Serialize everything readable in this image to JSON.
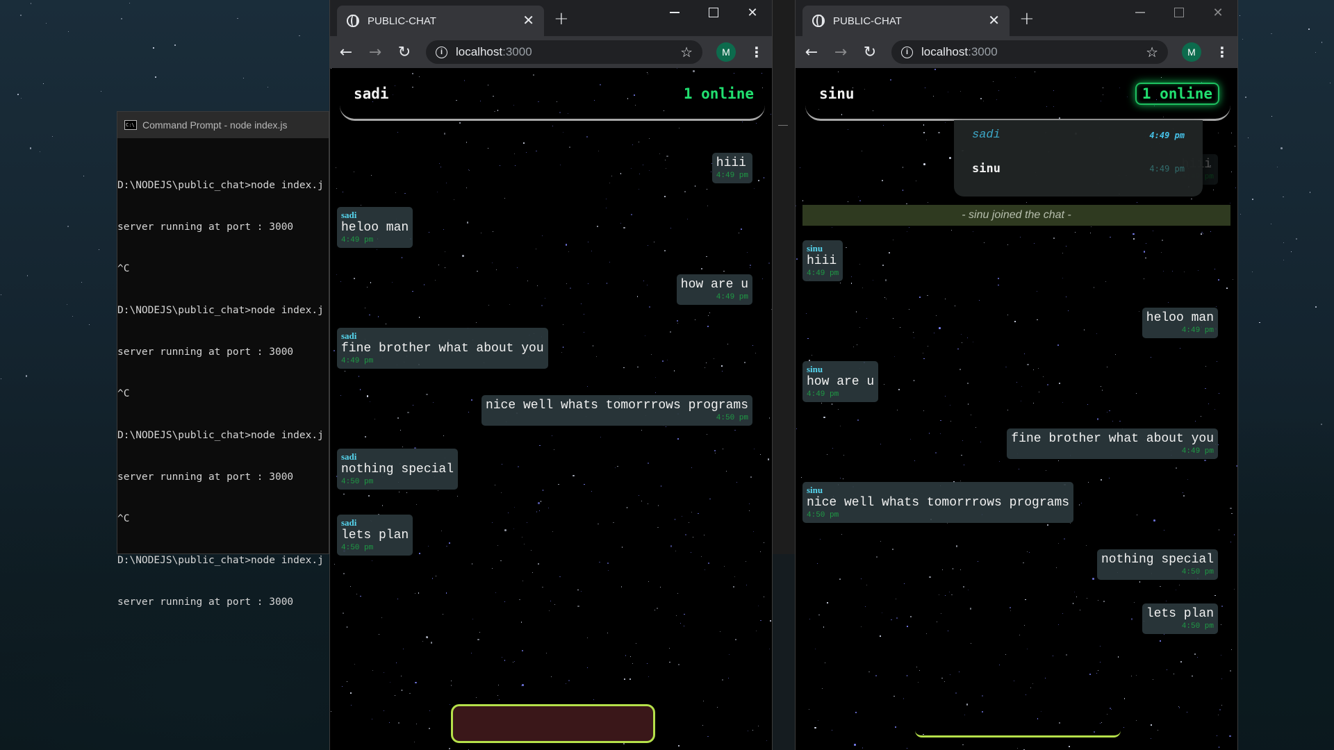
{
  "cmd": {
    "title": "Command Prompt - node  index.js",
    "lines": [
      "D:\\NODEJS\\public_chat>node index.j",
      "server running at port : 3000",
      "^C",
      "D:\\NODEJS\\public_chat>node index.j",
      "server running at port : 3000",
      "^C",
      "D:\\NODEJS\\public_chat>node index.j",
      "server running at port : 3000",
      "^C",
      "D:\\NODEJS\\public_chat>node index.j",
      "server running at port : 3000"
    ]
  },
  "browser_left": {
    "tab_title": "PUBLIC-CHAT",
    "url_host": "localhost",
    "url_port": ":3000",
    "avatar_letter": "M",
    "username": "sadi",
    "online": "1 online",
    "messages": [
      {
        "type": "outgoing",
        "sender": "",
        "text": "hiii",
        "time": "4:49 pm"
      },
      {
        "type": "incoming",
        "sender": "sadi",
        "text": "heloo man",
        "time": "4:49 pm"
      },
      {
        "type": "outgoing",
        "sender": "",
        "text": "how are u",
        "time": "4:49 pm"
      },
      {
        "type": "incoming",
        "sender": "sadi",
        "text": "fine brother what about you",
        "time": "4:49 pm"
      },
      {
        "type": "outgoing",
        "sender": "",
        "text": "nice well whats tomorrrows programs",
        "time": "4:50 pm"
      },
      {
        "type": "incoming",
        "sender": "sadi",
        "text": "nothing special",
        "time": "4:50 pm"
      },
      {
        "type": "incoming",
        "sender": "sadi",
        "text": "lets plan",
        "time": "4:50 pm"
      }
    ]
  },
  "browser_right": {
    "tab_title": "PUBLIC-CHAT",
    "url_host": "localhost",
    "url_port": ":3000",
    "avatar_letter": "M",
    "username": "sinu",
    "online": "1 online",
    "dropdown": [
      {
        "name": "sadi",
        "time": "4:49 pm"
      },
      {
        "name": "sinu",
        "time": "4:49 pm"
      }
    ],
    "join_notice": "- sinu joined the chat -",
    "messages": [
      {
        "type": "outgoing",
        "sender": "",
        "text": "hiii",
        "time": "4:49 pm"
      },
      {
        "type": "incoming",
        "sender": "sinu",
        "text": "hiii",
        "time": "4:49 pm"
      },
      {
        "type": "outgoing",
        "sender": "",
        "text": "heloo man",
        "time": "4:49 pm"
      },
      {
        "type": "incoming",
        "sender": "sinu",
        "text": "how are u",
        "time": "4:49 pm"
      },
      {
        "type": "outgoing",
        "sender": "",
        "text": "fine brother what about you",
        "time": "4:49 pm"
      },
      {
        "type": "incoming",
        "sender": "sinu",
        "text": "nice well whats tomorrrows programs",
        "time": "4:50 pm"
      },
      {
        "type": "outgoing",
        "sender": "",
        "text": "nothing special",
        "time": "4:50 pm"
      },
      {
        "type": "outgoing",
        "sender": "",
        "text": "lets plan",
        "time": "4:50 pm"
      }
    ]
  },
  "colors": {
    "online_green": "#21e070",
    "sender_cyan": "#56d6ef",
    "time_green": "#1f9a45",
    "input_border": "#b5e04a",
    "input_fill": "#3a1719",
    "bubble_bg": "#2c3a3e"
  }
}
